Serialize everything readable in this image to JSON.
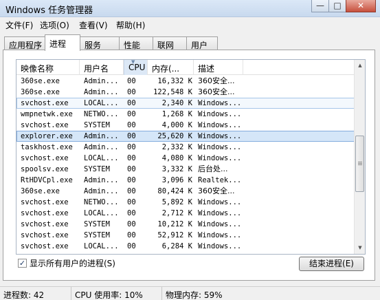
{
  "window": {
    "title": "Windows 任务管理器",
    "controls": {
      "minimize": "—",
      "maximize": "□",
      "close": "✕"
    }
  },
  "menu": [
    "文件(F)",
    "选项(O)",
    "查看(V)",
    "帮助(H)"
  ],
  "tabs": [
    "应用程序",
    "进程",
    "服务",
    "性能",
    "联网",
    "用户"
  ],
  "active_tab": "进程",
  "columns": {
    "name": "映像名称",
    "user": "用户名",
    "cpu": "CPU",
    "mem": "内存(...",
    "desc": "描述"
  },
  "processes": [
    {
      "name": "360se.exe",
      "user": "Admin...",
      "cpu": "00",
      "mem": "16,332 K",
      "desc": "360安全..."
    },
    {
      "name": "360se.exe",
      "user": "Admin...",
      "cpu": "00",
      "mem": "122,548 K",
      "desc": "360安全..."
    },
    {
      "name": "svchost.exe",
      "user": "LOCAL...",
      "cpu": "00",
      "mem": "2,340 K",
      "desc": "Windows..."
    },
    {
      "name": "wmpnetwk.exe",
      "user": "NETWO...",
      "cpu": "00",
      "mem": "1,268 K",
      "desc": "Windows..."
    },
    {
      "name": "svchost.exe",
      "user": "SYSTEM",
      "cpu": "00",
      "mem": "4,000 K",
      "desc": "Windows..."
    },
    {
      "name": "explorer.exe",
      "user": "Admin...",
      "cpu": "00",
      "mem": "25,620 K",
      "desc": "Windows..."
    },
    {
      "name": "taskhost.exe",
      "user": "Admin...",
      "cpu": "00",
      "mem": "2,332 K",
      "desc": "Windows..."
    },
    {
      "name": "svchost.exe",
      "user": "LOCAL...",
      "cpu": "00",
      "mem": "4,080 K",
      "desc": "Windows..."
    },
    {
      "name": "spoolsv.exe",
      "user": "SYSTEM",
      "cpu": "00",
      "mem": "3,332 K",
      "desc": "后台处..."
    },
    {
      "name": "RtHDVCpl.exe",
      "user": "Admin...",
      "cpu": "00",
      "mem": "3,096 K",
      "desc": "Realtek..."
    },
    {
      "name": "360se.exe",
      "user": "Admin...",
      "cpu": "00",
      "mem": "80,424 K",
      "desc": "360安全..."
    },
    {
      "name": "svchost.exe",
      "user": "NETWO...",
      "cpu": "00",
      "mem": "5,892 K",
      "desc": "Windows..."
    },
    {
      "name": "svchost.exe",
      "user": "LOCAL...",
      "cpu": "00",
      "mem": "2,712 K",
      "desc": "Windows..."
    },
    {
      "name": "svchost.exe",
      "user": "SYSTEM",
      "cpu": "00",
      "mem": "10,212 K",
      "desc": "Windows..."
    },
    {
      "name": "svchost.exe",
      "user": "SYSTEM",
      "cpu": "00",
      "mem": "52,912 K",
      "desc": "Windows..."
    },
    {
      "name": "svchost.exe",
      "user": "LOCAL...",
      "cpu": "00",
      "mem": "6,284 K",
      "desc": "Windows..."
    }
  ],
  "focused_row": 2,
  "selected_row": 5,
  "show_all_users": {
    "label": "显示所有用户的进程(S)",
    "checked": true
  },
  "end_process_button": "结束进程(E)",
  "status": {
    "processes": "进程数: 42",
    "cpu": "CPU 使用率: 10%",
    "memory": "物理内存: 59%"
  }
}
